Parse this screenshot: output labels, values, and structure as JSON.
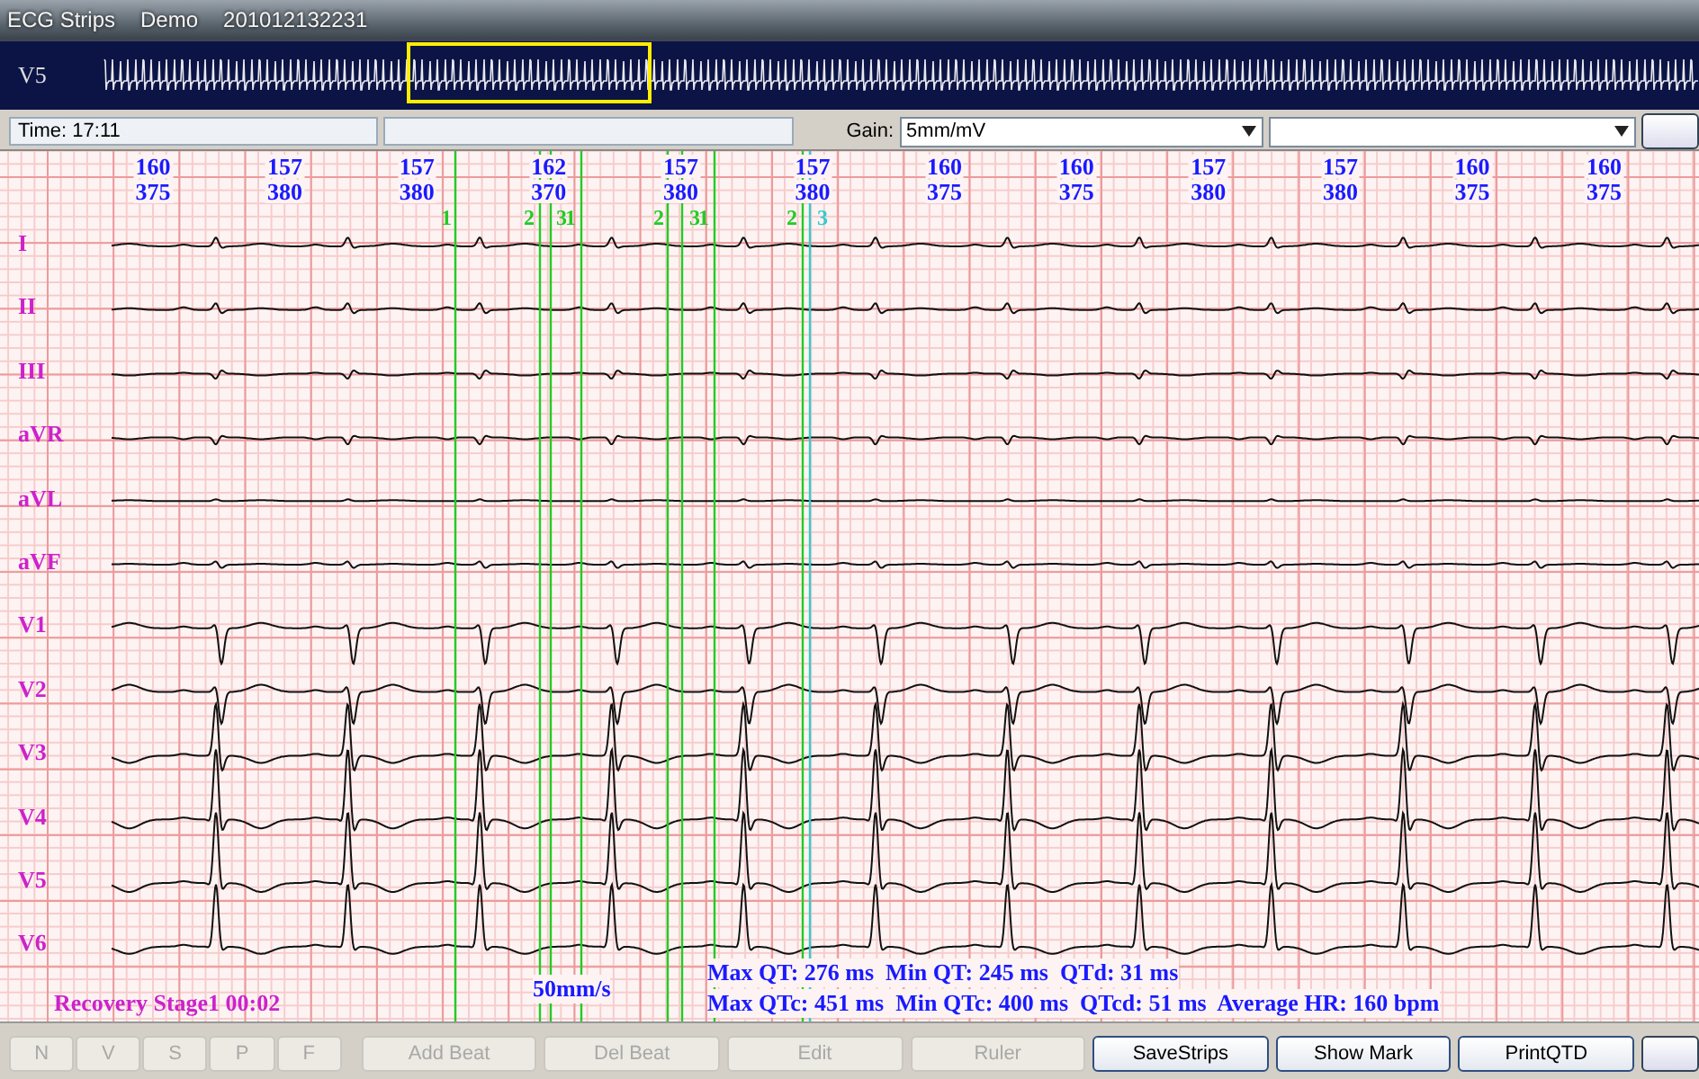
{
  "window": {
    "title": "ECG Strips",
    "mode": "Demo",
    "record_id": "201012132231"
  },
  "overview": {
    "lead": "V5"
  },
  "toolbar": {
    "time": "Time: 17:11",
    "gain_label": "Gain:",
    "gain_value": "5mm/mV"
  },
  "beats": [
    {
      "hr": "160",
      "qt": "375"
    },
    {
      "hr": "157",
      "qt": "380"
    },
    {
      "hr": "157",
      "qt": "380"
    },
    {
      "hr": "162",
      "qt": "370"
    },
    {
      "hr": "157",
      "qt": "380"
    },
    {
      "hr": "157",
      "qt": "380"
    },
    {
      "hr": "160",
      "qt": "375"
    },
    {
      "hr": "160",
      "qt": "375"
    },
    {
      "hr": "157",
      "qt": "380"
    },
    {
      "hr": "157",
      "qt": "380"
    },
    {
      "hr": "160",
      "qt": "375"
    },
    {
      "hr": "160",
      "qt": "375"
    }
  ],
  "markers": [
    {
      "label": "1",
      "color": "#22cc22"
    },
    {
      "label": "2",
      "color": "#22cc22"
    },
    {
      "label": "3",
      "color": "#22cc22"
    },
    {
      "label": "1",
      "color": "#22cc22"
    },
    {
      "label": "2",
      "color": "#22cc22"
    },
    {
      "label": "3",
      "color": "#22cc22"
    },
    {
      "label": "1",
      "color": "#22cc22"
    },
    {
      "label": "2",
      "color": "#22cc22"
    },
    {
      "label": "3",
      "color": "#33cccc"
    }
  ],
  "leads": [
    "I",
    "II",
    "III",
    "aVR",
    "aVL",
    "aVF",
    "V1",
    "V2",
    "V3",
    "V4",
    "V5",
    "V6"
  ],
  "status": {
    "stage": "Recovery Stage1 00:02",
    "speed": "50mm/s",
    "qt_line": "Max QT: 276 ms  Min QT: 245 ms  QTd: 31 ms",
    "qtc_line": "Max QTc: 451 ms  Min QTc: 400 ms  QTcd: 51 ms  Average HR: 160 bpm"
  },
  "buttons": [
    {
      "label": "N",
      "kind": "small",
      "disabled": true
    },
    {
      "label": "V",
      "kind": "small",
      "disabled": true
    },
    {
      "label": "S",
      "kind": "small",
      "disabled": true
    },
    {
      "label": "P",
      "kind": "small",
      "disabled": true
    },
    {
      "label": "F",
      "kind": "small",
      "disabled": true
    },
    {
      "label": "Add Beat",
      "kind": "wide",
      "disabled": true
    },
    {
      "label": "Del Beat",
      "kind": "wide",
      "disabled": true
    },
    {
      "label": "Edit",
      "kind": "wide",
      "disabled": true
    },
    {
      "label": "Ruler",
      "kind": "wide",
      "disabled": true
    },
    {
      "label": "SaveStrips",
      "kind": "wide",
      "disabled": false
    },
    {
      "label": "Show Mark",
      "kind": "wide",
      "disabled": false
    },
    {
      "label": "PrintQTD",
      "kind": "wide",
      "disabled": false
    }
  ]
}
